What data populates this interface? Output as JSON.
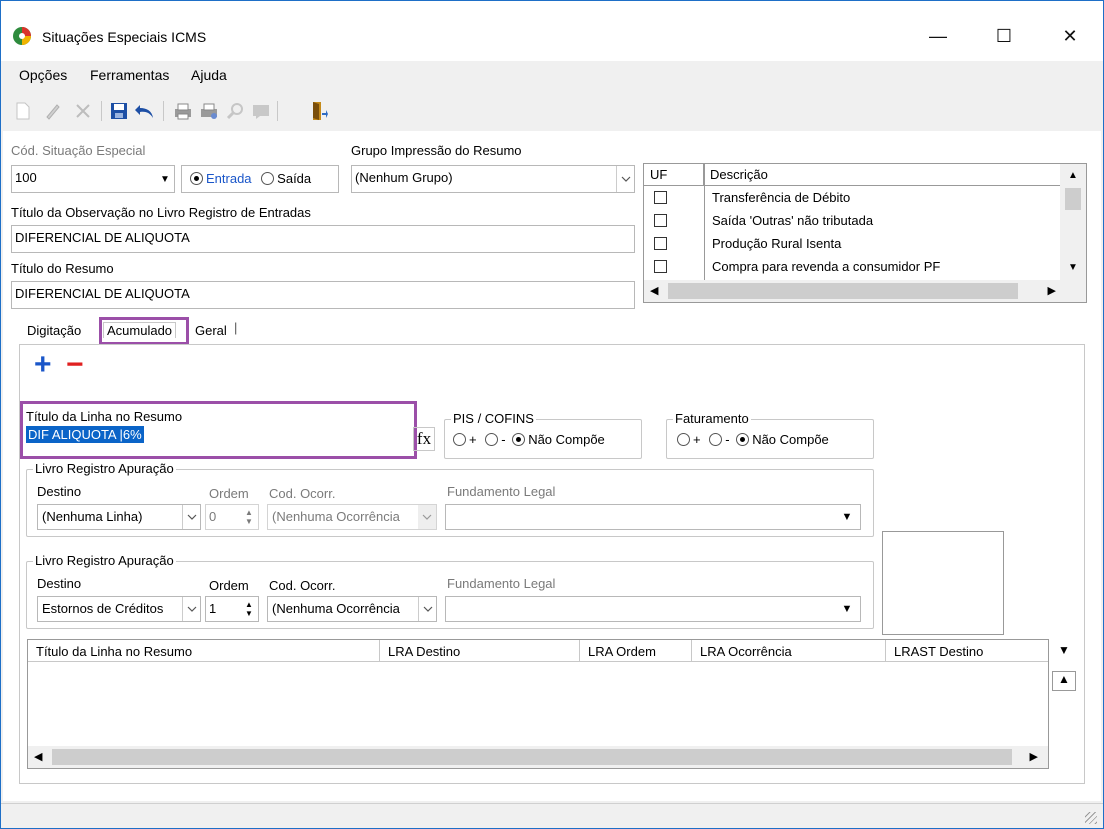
{
  "window": {
    "title": "Situações Especiais ICMS",
    "minimize": "—",
    "maximize": "☐",
    "close": "✕"
  },
  "menu": [
    "Opções",
    "Ferramentas",
    "Ajuda"
  ],
  "form": {
    "cod_label": "Cód. Situação Especial",
    "cod_value": "100",
    "radio_entrada": "Entrada",
    "radio_saida": "Saída",
    "grupo_label": "Grupo Impressão do Resumo",
    "grupo_value": "(Nenhum Grupo)",
    "titulo_obs_label": "Título da Observação no Livro Registro de Entradas",
    "titulo_obs_value": "DIFERENCIAL DE ALIQUOTA",
    "titulo_resumo_label": "Título do Resumo",
    "titulo_resumo_value": "DIFERENCIAL DE ALIQUOTA"
  },
  "uf_grid": {
    "headers": [
      "UF",
      "Descrição"
    ],
    "rows": [
      "Transferência de Débito",
      "Saída 'Outras' não tributada",
      "Produção Rural Isenta",
      "Compra para revenda a consumidor PF"
    ]
  },
  "tabs": [
    "Digitação",
    "Acumulado",
    "Geral"
  ],
  "acumulado": {
    "add": "+",
    "remove": "−",
    "linha_label": "Título da Linha no Resumo",
    "linha_value": "DIF ALIQUOTA |6%",
    "fx": "fx",
    "pis_label": "PIS / COFINS",
    "fat_label": "Faturamento",
    "opt_plus": "+",
    "opt_minus": "-",
    "opt_nao": "Não Compõe",
    "lra1": {
      "legend": "Livro Registro Apuração",
      "destino_label": "Destino",
      "ordem_label": "Ordem",
      "cod_label": "Cod. Ocorr.",
      "fund_label": "Fundamento Legal",
      "destino_value": "(Nenhuma Linha)",
      "ordem_value": "0",
      "cod_value": "(Nenhuma Ocorrência"
    },
    "lra2": {
      "legend": "Livro Registro Apuração",
      "destino_label": "Destino",
      "ordem_label": "Ordem",
      "cod_label": "Cod. Ocorr.",
      "fund_label": "Fundamento Legal",
      "destino_value": "Estornos de Créditos",
      "ordem_value": "1",
      "cod_value": "(Nenhuma Ocorrência"
    },
    "grid_headers": [
      "Título da Linha no Resumo",
      "LRA Destino",
      "LRA Ordem",
      "LRA Ocorrência",
      "LRAST Destino"
    ]
  }
}
